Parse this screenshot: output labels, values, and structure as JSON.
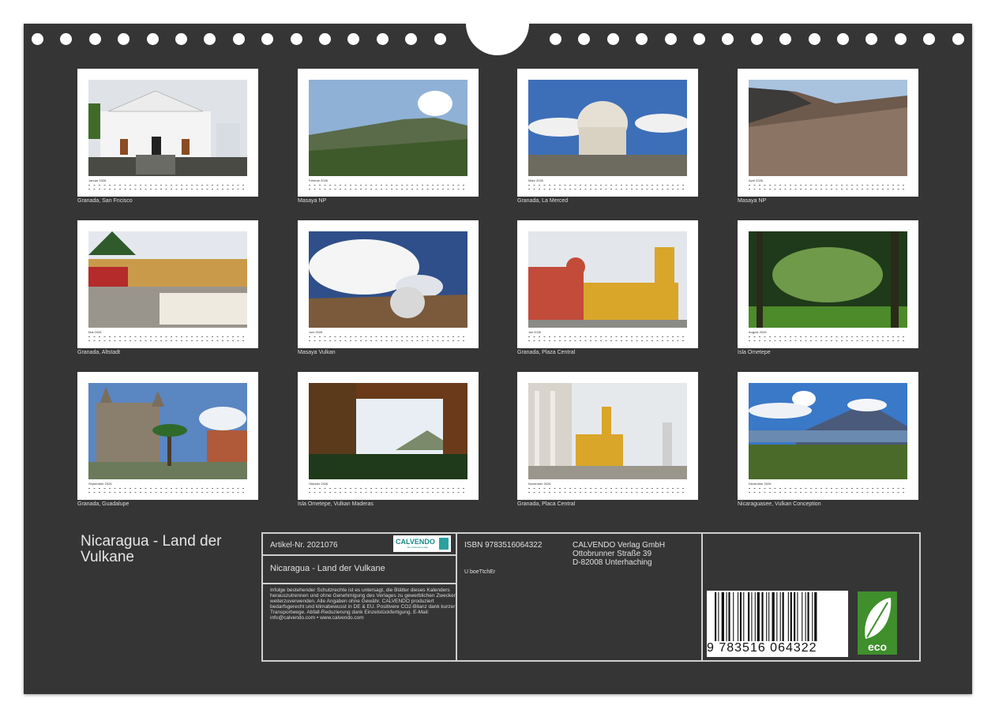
{
  "title": "Nicaragua - Land der Vulkane",
  "months": [
    {
      "month": "Januar 2026",
      "caption": "Granada, San Fncisco",
      "icon": "church-facade-icon"
    },
    {
      "month": "Februar 2026",
      "caption": "Masaya NP",
      "icon": "volcano-landscape-icon"
    },
    {
      "month": "März 2026",
      "caption": "Granada, La Merced",
      "icon": "cathedral-dome-icon"
    },
    {
      "month": "April 2026",
      "caption": "Masaya NP",
      "icon": "crater-landscape-icon"
    },
    {
      "month": "Mai 2026",
      "caption": "Granada, Altstadt",
      "icon": "old-town-icon"
    },
    {
      "month": "Juni 2026",
      "caption": "Masaya Vulkan",
      "icon": "volcano-smoke-icon"
    },
    {
      "month": "Juli 2026",
      "caption": "Granada, Plaza Central",
      "icon": "cathedral-icon"
    },
    {
      "month": "August 2026",
      "caption": "Isla Ometepe",
      "icon": "jungle-icon"
    },
    {
      "month": "September 2026",
      "caption": "Granada, Guadalupe",
      "icon": "church-palm-icon"
    },
    {
      "month": "Oktober 2026",
      "caption": "Isla Ometepe, Vulkan Maderas",
      "icon": "trees-volcano-icon"
    },
    {
      "month": "November 2026",
      "caption": "Granada, Placa Central",
      "icon": "plaza-colonnade-icon"
    },
    {
      "month": "Dezember 2026",
      "caption": "Nicaraguasee, Vulkan Conception",
      "icon": "volcano-lake-icon"
    }
  ],
  "info": {
    "article": "Artikel-Nr. 2021076",
    "logo_text": "CALVENDO",
    "logo_sub": "Der Kalenderverlag",
    "book_title": "Nicaragua - Land der Vulkane",
    "legal": "Infolge bestehender Schutzrechte ist es untersagt, die Blätter dieses Kalenders herauszutrennen und ohne Genehmigung des Verlages zu gewerblichen Zwecken weiterzuverwenden. Alle Angaben ohne Gewähr. CALVENDO produziert bedarfsgerecht und klimabewusst in DE & EU. Positivere CO2-Bilanz dank kurzer Transportwege. Abfall-Reduzierung dank Einzelstückfertigung. E-Mail: info@calvendo.com • www.calvendo.com",
    "isbn": "ISBN 9783516064322",
    "author": "U boeTtchEr",
    "publisher_name": "CALVENDO Verlag GmbH",
    "publisher_street": "Ottobrunner Straße 39",
    "publisher_city": "D-82008 Unterhaching",
    "barcode_digits": "9 783516 064322",
    "eco_label": "eco"
  }
}
